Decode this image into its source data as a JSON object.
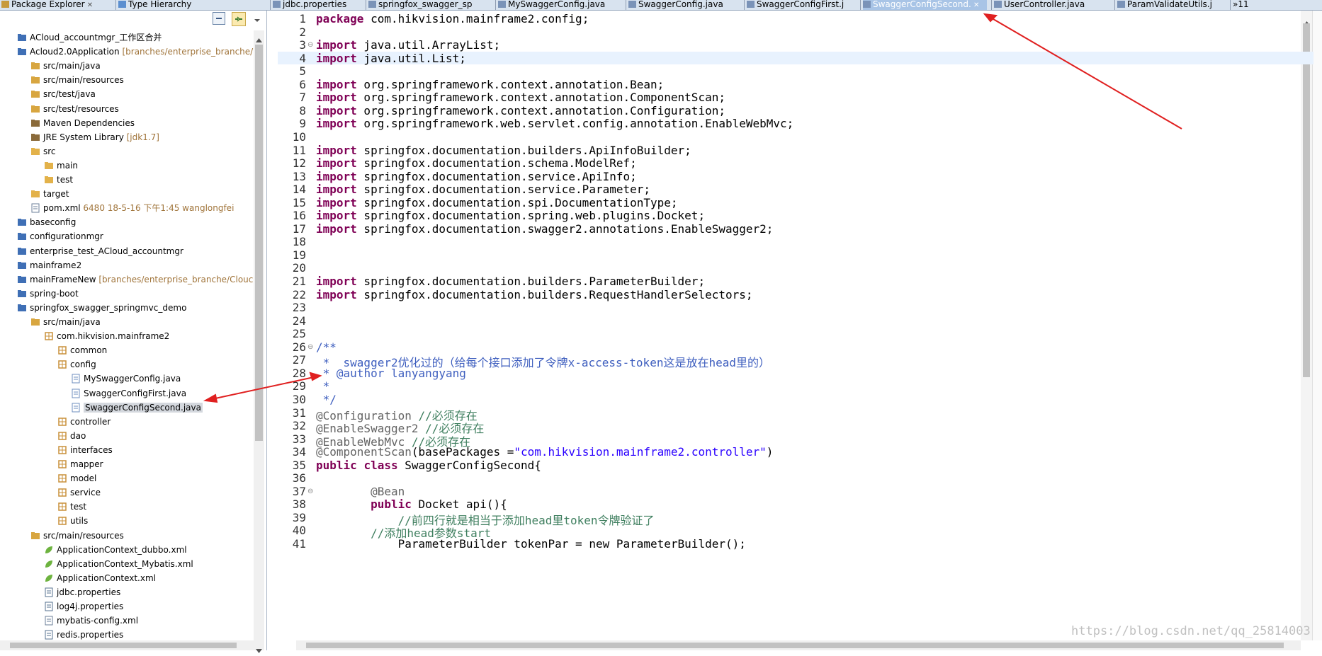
{
  "tabs": [
    {
      "label": "Package Explorer",
      "active": true,
      "closable": true
    },
    {
      "label": "Type Hierarchy"
    },
    {
      "label": "jdbc.properties"
    },
    {
      "label": "springfox_swagger_sp"
    },
    {
      "label": "MySwaggerConfig.java"
    },
    {
      "label": "SwaggerConfig.java"
    },
    {
      "label": "SwaggerConfigFirst.j"
    },
    {
      "label": "SwaggerConfigSecond.",
      "active": true,
      "closable": true
    },
    {
      "label": "UserController.java"
    },
    {
      "label": "ParamValidateUtils.j"
    },
    {
      "label": "»11"
    }
  ],
  "tree": [
    {
      "label": "ACloud_accountmgr_工作区合并",
      "icon": "project-icon"
    },
    {
      "label": "Acloud2.0Application",
      "decoration": "[branches/enterprise_branche/",
      "icon": "project-icon"
    },
    {
      "label": "src/main/java",
      "icon": "source-folder-icon"
    },
    {
      "label": "src/main/resources",
      "icon": "source-folder-icon"
    },
    {
      "label": "src/test/java",
      "icon": "source-folder-icon"
    },
    {
      "label": "src/test/resources",
      "icon": "source-folder-icon"
    },
    {
      "label": "Maven Dependencies",
      "icon": "library-icon"
    },
    {
      "label": "JRE System Library",
      "decoration": "[jdk1.7]",
      "icon": "library-icon"
    },
    {
      "label": "src",
      "icon": "folder-icon"
    },
    {
      "label": "main",
      "icon": "folder-icon"
    },
    {
      "label": "test",
      "icon": "folder-icon"
    },
    {
      "label": "target",
      "icon": "folder-icon"
    },
    {
      "label": "pom.xml",
      "decoration": "6480  18-5-16 下午1:45  wanglongfei",
      "icon": "xml-file-icon"
    },
    {
      "label": "baseconfig",
      "icon": "project-icon"
    },
    {
      "label": "configurationmgr",
      "icon": "project-icon"
    },
    {
      "label": "enterprise_test_ACloud_accountmgr",
      "icon": "project-icon"
    },
    {
      "label": "mainframe2",
      "icon": "project-icon"
    },
    {
      "label": "mainFrameNew",
      "decoration": "[branches/enterprise_branche/Clouc",
      "icon": "project-icon"
    },
    {
      "label": "spring-boot",
      "icon": "project-icon"
    },
    {
      "label": "springfox_swagger_springmvc_demo",
      "icon": "project-icon"
    },
    {
      "label": "src/main/java",
      "icon": "source-folder-icon"
    },
    {
      "label": "com.hikvision.mainframe2",
      "icon": "package-icon"
    },
    {
      "label": "common",
      "icon": "package-icon"
    },
    {
      "label": "config",
      "icon": "package-icon"
    },
    {
      "label": "MySwaggerConfig.java",
      "icon": "java-file-icon"
    },
    {
      "label": "SwaggerConfigFirst.java",
      "icon": "java-file-icon"
    },
    {
      "label": "SwaggerConfigSecond.java",
      "icon": "java-file-icon",
      "selected": true
    },
    {
      "label": "controller",
      "icon": "package-icon"
    },
    {
      "label": "dao",
      "icon": "package-icon"
    },
    {
      "label": "interfaces",
      "icon": "package-icon"
    },
    {
      "label": "mapper",
      "icon": "package-icon"
    },
    {
      "label": "model",
      "icon": "package-icon"
    },
    {
      "label": "service",
      "icon": "package-icon"
    },
    {
      "label": "test",
      "icon": "package-icon"
    },
    {
      "label": "utils",
      "icon": "package-icon"
    },
    {
      "label": "src/main/resources",
      "icon": "source-folder-icon"
    },
    {
      "label": "ApplicationContext_dubbo.xml",
      "icon": "spring-xml-icon"
    },
    {
      "label": "ApplicationContext_Mybatis.xml",
      "icon": "spring-xml-icon"
    },
    {
      "label": "ApplicationContext.xml",
      "icon": "spring-xml-icon"
    },
    {
      "label": "jdbc.properties",
      "icon": "properties-file-icon"
    },
    {
      "label": "log4j.properties",
      "icon": "properties-file-icon"
    },
    {
      "label": "mybatis-config.xml",
      "icon": "xml-file-icon"
    },
    {
      "label": "redis.properties",
      "icon": "properties-file-icon"
    }
  ],
  "code": [
    [
      {
        "t": "package",
        "c": "kw"
      },
      {
        "t": " com.hikvision.mainframe2.config;"
      }
    ],
    [],
    [
      {
        "t": "import",
        "c": "kw"
      },
      {
        "t": " java.util.ArrayList;"
      }
    ],
    [
      {
        "t": "import",
        "c": "kw"
      },
      {
        "t": " java.util.List;"
      }
    ],
    [],
    [
      {
        "t": "import",
        "c": "kw"
      },
      {
        "t": " org.springframework.context.annotation.Bean;"
      }
    ],
    [
      {
        "t": "import",
        "c": "kw"
      },
      {
        "t": " org.springframework.context.annotation.ComponentScan;"
      }
    ],
    [
      {
        "t": "import",
        "c": "kw"
      },
      {
        "t": " org.springframework.context.annotation.Configuration;"
      }
    ],
    [
      {
        "t": "import",
        "c": "kw"
      },
      {
        "t": " org.springframework.web.servlet.config.annotation.EnableWebMvc;"
      }
    ],
    [],
    [
      {
        "t": "import",
        "c": "kw"
      },
      {
        "t": " springfox.documentation.builders.ApiInfoBuilder;"
      }
    ],
    [
      {
        "t": "import",
        "c": "kw"
      },
      {
        "t": " springfox.documentation.schema.ModelRef;"
      }
    ],
    [
      {
        "t": "import",
        "c": "kw"
      },
      {
        "t": " springfox.documentation.service.ApiInfo;"
      }
    ],
    [
      {
        "t": "import",
        "c": "kw"
      },
      {
        "t": " springfox.documentation.service.Parameter;"
      }
    ],
    [
      {
        "t": "import",
        "c": "kw"
      },
      {
        "t": " springfox.documentation.spi.DocumentationType;"
      }
    ],
    [
      {
        "t": "import",
        "c": "kw"
      },
      {
        "t": " springfox.documentation.spring.web.plugins.Docket;"
      }
    ],
    [
      {
        "t": "import",
        "c": "kw"
      },
      {
        "t": " springfox.documentation.swagger2.annotations.EnableSwagger2;"
      }
    ],
    [],
    [],
    [],
    [
      {
        "t": "import",
        "c": "kw"
      },
      {
        "t": " springfox.documentation.builders.ParameterBuilder;"
      }
    ],
    [
      {
        "t": "import",
        "c": "kw"
      },
      {
        "t": " springfox.documentation.builders.RequestHandlerSelectors;"
      }
    ],
    [],
    [],
    [],
    [
      {
        "t": "/**",
        "c": "jd"
      }
    ],
    [
      {
        "t": " *  swagger2优化过的（给每个接口添加了令牌x-access-token这是放在head里的）",
        "c": "jd"
      }
    ],
    [
      {
        "t": " * ",
        "c": "jd"
      },
      {
        "t": "@author",
        "c": "jd"
      },
      {
        "t": " lanyangyang",
        "c": "jd"
      }
    ],
    [
      {
        "t": " *",
        "c": "jd"
      }
    ],
    [
      {
        "t": " */",
        "c": "jd"
      }
    ],
    [
      {
        "t": "@Configuration",
        "c": "an"
      },
      {
        "t": " //必须存在",
        "c": "cm"
      }
    ],
    [
      {
        "t": "@EnableSwagger2",
        "c": "an"
      },
      {
        "t": " //必须存在",
        "c": "cm"
      }
    ],
    [
      {
        "t": "@EnableWebMvc",
        "c": "an"
      },
      {
        "t": " //必须存在",
        "c": "cm"
      }
    ],
    [
      {
        "t": "@ComponentScan",
        "c": "an"
      },
      {
        "t": "(basePackages ="
      },
      {
        "t": "\"com.hikvision.mainframe2.controller\"",
        "c": "st"
      },
      {
        "t": ")"
      }
    ],
    [
      {
        "t": "public",
        "c": "kw"
      },
      {
        "t": " "
      },
      {
        "t": "class",
        "c": "kw"
      },
      {
        "t": " SwaggerConfigSecond{"
      }
    ],
    [],
    [
      {
        "t": "        "
      },
      {
        "t": "@Bean",
        "c": "an"
      }
    ],
    [
      {
        "t": "        "
      },
      {
        "t": "public",
        "c": "kw"
      },
      {
        "t": " Docket api(){"
      }
    ],
    [
      {
        "t": "            //前四行就是相当于添加head里token令牌验证了",
        "c": "cm"
      }
    ],
    [
      {
        "t": "        //添加head参数start",
        "c": "cm"
      }
    ],
    [
      {
        "t": "            ParameterBuilder tokenPar = new ParameterBuilder();"
      }
    ]
  ],
  "watermark": "https://blog.csdn.net/qq_25814003"
}
